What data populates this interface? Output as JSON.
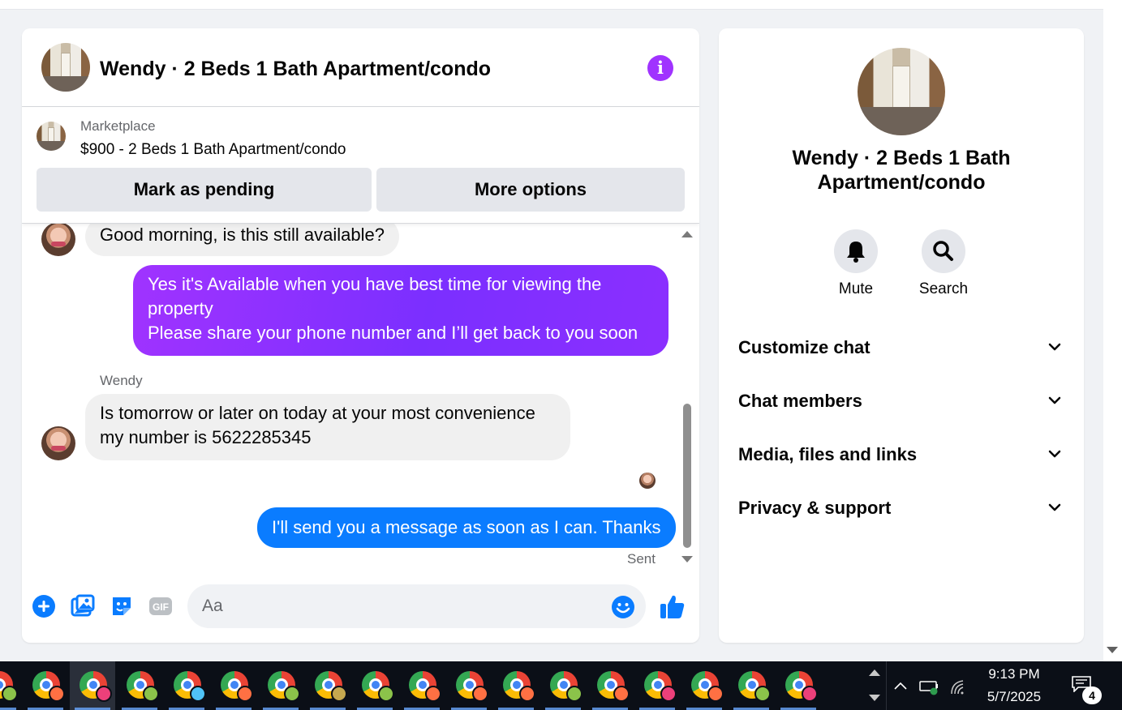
{
  "chat": {
    "title": "Wendy · 2 Beds 1 Bath Apartment/condo",
    "info_icon": "info-icon"
  },
  "marketplace": {
    "label": "Marketplace",
    "item": "$900 - 2 Beds 1 Bath Apartment/condo",
    "mark_pending": "Mark as pending",
    "more_options": "More options"
  },
  "messages": [
    {
      "from": "them",
      "text": "Good morning, is this still available?"
    },
    {
      "from": "me",
      "lines": [
        "Yes it's Available when you have best time for viewing the property",
        "Please share your phone number and I’ll get back to you soon"
      ]
    },
    {
      "from": "them",
      "sender": "Wendy",
      "lines": [
        "Is tomorrow or later on today at your most convenience",
        "my number is 5622285345"
      ]
    },
    {
      "from": "me",
      "text": "I'll send you a message as soon as I can. Thanks",
      "status": "Sent"
    }
  ],
  "composer": {
    "placeholder": "Aa",
    "icons": [
      "plus-circle-icon",
      "image-icon",
      "sticker-icon",
      "gif-icon",
      "emoji-icon",
      "thumbs-up-icon"
    ]
  },
  "info_panel": {
    "title": "Wendy · 2 Beds 1 Bath Apartment/condo",
    "actions": [
      {
        "label": "Mute",
        "icon": "bell-icon"
      },
      {
        "label": "Search",
        "icon": "search-icon"
      }
    ],
    "sections": [
      "Customize chat",
      "Chat members",
      "Media, files and links",
      "Privacy & support"
    ]
  },
  "taskbar": {
    "time": "9:13 PM",
    "date": "5/7/2025",
    "notification_count": "4",
    "app_icon": "chrome-icon",
    "badge_colors": [
      "#8bc34a",
      "#ff7043",
      "#ec407a",
      "#8bc34a",
      "#4fc3f7",
      "#ff7043",
      "#8bc34a",
      "#c5a84f",
      "#8bc34a",
      "#ff7043",
      "#ff7043",
      "#ff7043",
      "#8bc34a",
      "#ff7043",
      "#ec407a",
      "#ff7043",
      "#8bc34a",
      "#ec407a"
    ]
  },
  "colors": {
    "accent_purple": "#a033ff",
    "messenger_blue": "#0a7cff",
    "bubble_gray": "#f0f0f0"
  }
}
